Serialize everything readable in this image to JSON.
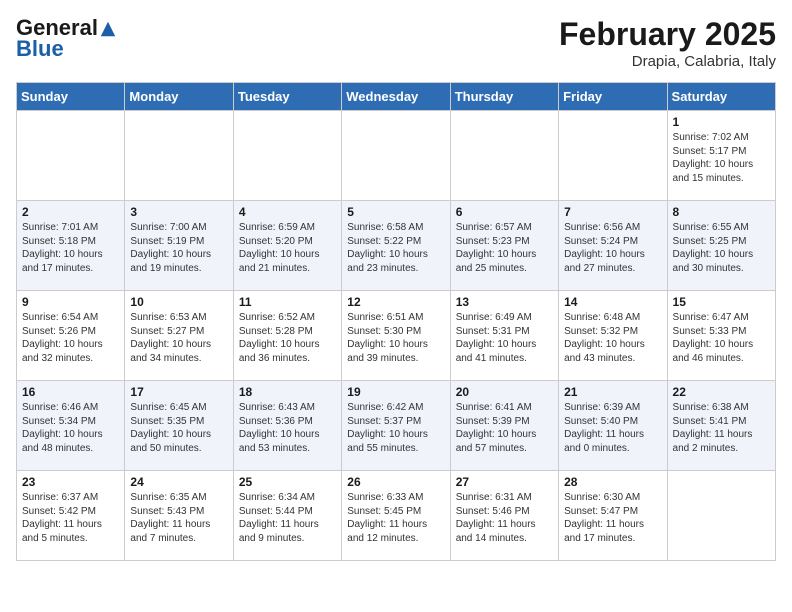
{
  "header": {
    "logo_line1": "General",
    "logo_line2": "Blue",
    "month": "February 2025",
    "location": "Drapia, Calabria, Italy"
  },
  "weekdays": [
    "Sunday",
    "Monday",
    "Tuesday",
    "Wednesday",
    "Thursday",
    "Friday",
    "Saturday"
  ],
  "weeks": [
    [
      {
        "day": "",
        "info": ""
      },
      {
        "day": "",
        "info": ""
      },
      {
        "day": "",
        "info": ""
      },
      {
        "day": "",
        "info": ""
      },
      {
        "day": "",
        "info": ""
      },
      {
        "day": "",
        "info": ""
      },
      {
        "day": "1",
        "info": "Sunrise: 7:02 AM\nSunset: 5:17 PM\nDaylight: 10 hours\nand 15 minutes."
      }
    ],
    [
      {
        "day": "2",
        "info": "Sunrise: 7:01 AM\nSunset: 5:18 PM\nDaylight: 10 hours\nand 17 minutes."
      },
      {
        "day": "3",
        "info": "Sunrise: 7:00 AM\nSunset: 5:19 PM\nDaylight: 10 hours\nand 19 minutes."
      },
      {
        "day": "4",
        "info": "Sunrise: 6:59 AM\nSunset: 5:20 PM\nDaylight: 10 hours\nand 21 minutes."
      },
      {
        "day": "5",
        "info": "Sunrise: 6:58 AM\nSunset: 5:22 PM\nDaylight: 10 hours\nand 23 minutes."
      },
      {
        "day": "6",
        "info": "Sunrise: 6:57 AM\nSunset: 5:23 PM\nDaylight: 10 hours\nand 25 minutes."
      },
      {
        "day": "7",
        "info": "Sunrise: 6:56 AM\nSunset: 5:24 PM\nDaylight: 10 hours\nand 27 minutes."
      },
      {
        "day": "8",
        "info": "Sunrise: 6:55 AM\nSunset: 5:25 PM\nDaylight: 10 hours\nand 30 minutes."
      }
    ],
    [
      {
        "day": "9",
        "info": "Sunrise: 6:54 AM\nSunset: 5:26 PM\nDaylight: 10 hours\nand 32 minutes."
      },
      {
        "day": "10",
        "info": "Sunrise: 6:53 AM\nSunset: 5:27 PM\nDaylight: 10 hours\nand 34 minutes."
      },
      {
        "day": "11",
        "info": "Sunrise: 6:52 AM\nSunset: 5:28 PM\nDaylight: 10 hours\nand 36 minutes."
      },
      {
        "day": "12",
        "info": "Sunrise: 6:51 AM\nSunset: 5:30 PM\nDaylight: 10 hours\nand 39 minutes."
      },
      {
        "day": "13",
        "info": "Sunrise: 6:49 AM\nSunset: 5:31 PM\nDaylight: 10 hours\nand 41 minutes."
      },
      {
        "day": "14",
        "info": "Sunrise: 6:48 AM\nSunset: 5:32 PM\nDaylight: 10 hours\nand 43 minutes."
      },
      {
        "day": "15",
        "info": "Sunrise: 6:47 AM\nSunset: 5:33 PM\nDaylight: 10 hours\nand 46 minutes."
      }
    ],
    [
      {
        "day": "16",
        "info": "Sunrise: 6:46 AM\nSunset: 5:34 PM\nDaylight: 10 hours\nand 48 minutes."
      },
      {
        "day": "17",
        "info": "Sunrise: 6:45 AM\nSunset: 5:35 PM\nDaylight: 10 hours\nand 50 minutes."
      },
      {
        "day": "18",
        "info": "Sunrise: 6:43 AM\nSunset: 5:36 PM\nDaylight: 10 hours\nand 53 minutes."
      },
      {
        "day": "19",
        "info": "Sunrise: 6:42 AM\nSunset: 5:37 PM\nDaylight: 10 hours\nand 55 minutes."
      },
      {
        "day": "20",
        "info": "Sunrise: 6:41 AM\nSunset: 5:39 PM\nDaylight: 10 hours\nand 57 minutes."
      },
      {
        "day": "21",
        "info": "Sunrise: 6:39 AM\nSunset: 5:40 PM\nDaylight: 11 hours\nand 0 minutes."
      },
      {
        "day": "22",
        "info": "Sunrise: 6:38 AM\nSunset: 5:41 PM\nDaylight: 11 hours\nand 2 minutes."
      }
    ],
    [
      {
        "day": "23",
        "info": "Sunrise: 6:37 AM\nSunset: 5:42 PM\nDaylight: 11 hours\nand 5 minutes."
      },
      {
        "day": "24",
        "info": "Sunrise: 6:35 AM\nSunset: 5:43 PM\nDaylight: 11 hours\nand 7 minutes."
      },
      {
        "day": "25",
        "info": "Sunrise: 6:34 AM\nSunset: 5:44 PM\nDaylight: 11 hours\nand 9 minutes."
      },
      {
        "day": "26",
        "info": "Sunrise: 6:33 AM\nSunset: 5:45 PM\nDaylight: 11 hours\nand 12 minutes."
      },
      {
        "day": "27",
        "info": "Sunrise: 6:31 AM\nSunset: 5:46 PM\nDaylight: 11 hours\nand 14 minutes."
      },
      {
        "day": "28",
        "info": "Sunrise: 6:30 AM\nSunset: 5:47 PM\nDaylight: 11 hours\nand 17 minutes."
      },
      {
        "day": "",
        "info": ""
      }
    ]
  ]
}
